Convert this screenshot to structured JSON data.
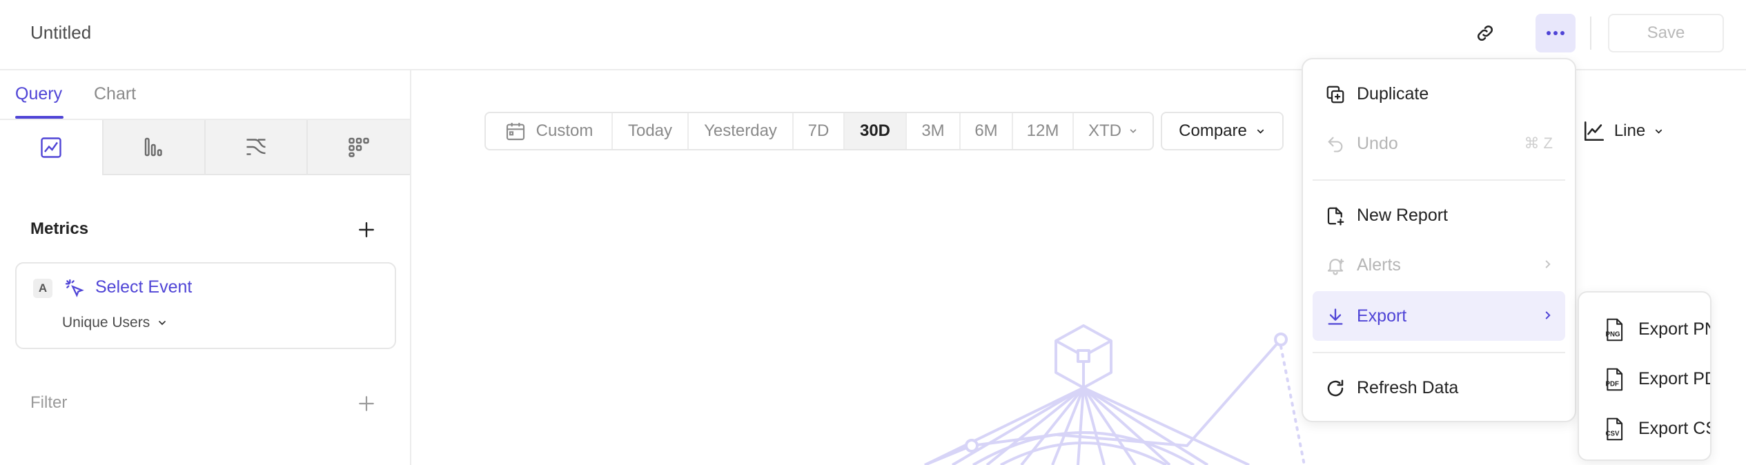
{
  "header": {
    "title": "Untitled",
    "save_label": "Save"
  },
  "left_panel": {
    "tabs": [
      {
        "label": "Query",
        "active": true
      },
      {
        "label": "Chart",
        "active": false
      }
    ],
    "chart_types": [
      "insights-icon",
      "funnels-icon",
      "flows-icon",
      "retention-icon"
    ],
    "metrics_heading": "Metrics",
    "metric": {
      "badge": "A",
      "event_label": "Select Event",
      "measure": "Unique Users"
    },
    "filter_heading": "Filter"
  },
  "date_range": {
    "custom_label": "Custom",
    "options": [
      "Today",
      "Yesterday",
      "7D",
      "30D",
      "3M",
      "6M",
      "12M",
      "XTD"
    ],
    "selected": "30D"
  },
  "compare_label": "Compare",
  "line_label": "Line",
  "more_menu": {
    "items": [
      {
        "label": "Duplicate",
        "icon": "duplicate-icon"
      },
      {
        "label": "Undo",
        "icon": "undo-icon",
        "shortcut": "⌘ Z",
        "disabled": true
      },
      {
        "label": "New Report",
        "icon": "new-report-icon"
      },
      {
        "label": "Alerts",
        "icon": "bell-icon",
        "disabled": true
      },
      {
        "label": "Export",
        "icon": "download-icon",
        "active": true
      },
      {
        "label": "Refresh Data",
        "icon": "refresh-icon"
      }
    ]
  },
  "export_submenu": {
    "items": [
      {
        "label": "Export PNG",
        "icon": "png-file-icon"
      },
      {
        "label": "Export PDF",
        "icon": "pdf-file-icon"
      },
      {
        "label": "Export CSV",
        "icon": "csv-file-icon"
      }
    ]
  },
  "colors": {
    "accent": "#4f44d6",
    "accent_bg": "#efeefc",
    "illustration": "#d7d4f7"
  }
}
